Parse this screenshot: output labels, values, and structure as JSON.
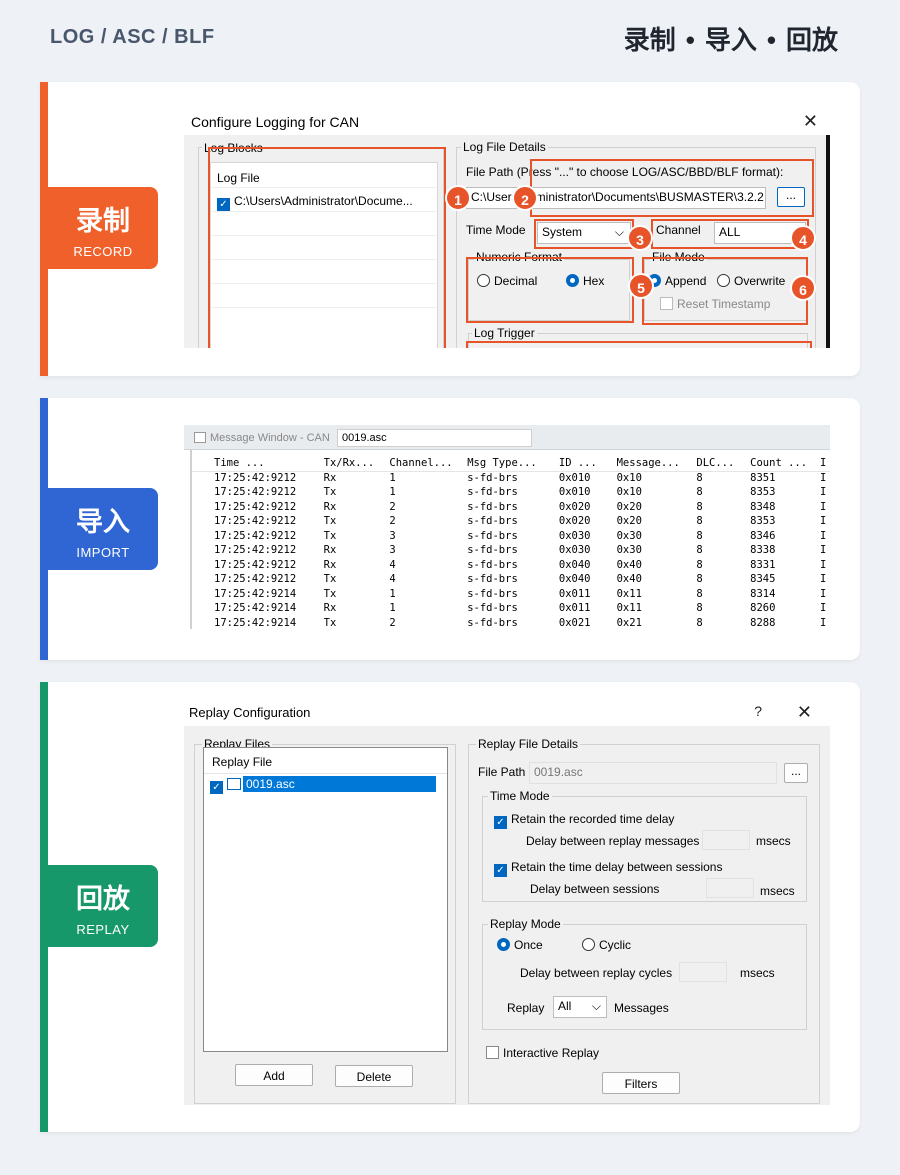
{
  "header": {
    "left": "LOG / ASC / BLF",
    "right": [
      "录制",
      "导入",
      "回放"
    ],
    "dot": "•"
  },
  "colors": {
    "record": "#f0602b",
    "import": "#2f66d4",
    "replay": "#17986a",
    "annot": "#e8542a"
  },
  "record": {
    "badge_cn": "录制",
    "badge_en": "RECORD",
    "window_title": "Configure Logging for CAN",
    "close": "✕",
    "log_blocks_label": "Log Blocks",
    "log_file_header": "Log File",
    "log_file_item": "C:\\Users\\Administrator\\Docume...",
    "details_label": "Log File Details",
    "file_path_label": "File Path (Press \"...\" to choose LOG/ASC/BBD/BLF format):",
    "file_path_value": "C:\\Users\\Administrator\\Documents\\BUSMASTER\\3.2.2",
    "browse": "...",
    "time_mode_label": "Time Mode",
    "time_mode_value": "System",
    "channel_label": "Channel",
    "channel_value": "ALL",
    "numeric_format_label": "Numeric Format",
    "decimal": "Decimal",
    "hex": "Hex",
    "file_mode_label": "File Mode",
    "append": "Append",
    "overwrite": "Overwrite",
    "reset_ts": "Reset Timestamp",
    "log_trigger": "Log Trigger",
    "markers": [
      "1",
      "2",
      "3",
      "4",
      "5",
      "6"
    ]
  },
  "import": {
    "badge_cn": "导入",
    "badge_en": "IMPORT",
    "window_title": "Message Window - CAN",
    "tab": "0019.asc",
    "columns": [
      "Time ...",
      "Tx/Rx...",
      "Channel...",
      "Msg Type...",
      "ID ...",
      "Message...",
      "DLC...",
      "Count ...",
      "I"
    ],
    "rows": [
      [
        "17:25:42:9212",
        "Rx",
        "1",
        "s-fd-brs",
        "0x010",
        "0x10",
        "8",
        "8351",
        "I"
      ],
      [
        "17:25:42:9212",
        "Tx",
        "1",
        "s-fd-brs",
        "0x010",
        "0x10",
        "8",
        "8353",
        "I"
      ],
      [
        "17:25:42:9212",
        "Rx",
        "2",
        "s-fd-brs",
        "0x020",
        "0x20",
        "8",
        "8348",
        "I"
      ],
      [
        "17:25:42:9212",
        "Tx",
        "2",
        "s-fd-brs",
        "0x020",
        "0x20",
        "8",
        "8353",
        "I"
      ],
      [
        "17:25:42:9212",
        "Tx",
        "3",
        "s-fd-brs",
        "0x030",
        "0x30",
        "8",
        "8346",
        "I"
      ],
      [
        "17:25:42:9212",
        "Rx",
        "3",
        "s-fd-brs",
        "0x030",
        "0x30",
        "8",
        "8338",
        "I"
      ],
      [
        "17:25:42:9212",
        "Rx",
        "4",
        "s-fd-brs",
        "0x040",
        "0x40",
        "8",
        "8331",
        "I"
      ],
      [
        "17:25:42:9212",
        "Tx",
        "4",
        "s-fd-brs",
        "0x040",
        "0x40",
        "8",
        "8345",
        "I"
      ],
      [
        "17:25:42:9214",
        "Tx",
        "1",
        "s-fd-brs",
        "0x011",
        "0x11",
        "8",
        "8314",
        "I"
      ],
      [
        "17:25:42:9214",
        "Rx",
        "1",
        "s-fd-brs",
        "0x011",
        "0x11",
        "8",
        "8260",
        "I"
      ],
      [
        "17:25:42:9214",
        "Tx",
        "2",
        "s-fd-brs",
        "0x021",
        "0x21",
        "8",
        "8288",
        "I"
      ]
    ]
  },
  "replay": {
    "badge_cn": "回放",
    "badge_en": "REPLAY",
    "window_title": "Replay Configuration",
    "help": "?",
    "close": "✕",
    "files_label": "Replay Files",
    "file_header": "Replay File",
    "file_item": "0019.asc",
    "add": "Add",
    "delete": "Delete",
    "details_label": "Replay File Details",
    "file_path_label": "File Path",
    "file_path_value": "0019.asc",
    "browse": "...",
    "time_mode_label": "Time Mode",
    "retain_recorded": "Retain the recorded time delay",
    "delay_messages": "Delay between replay messages",
    "retain_sessions": "Retain the time delay between sessions",
    "delay_sessions": "Delay between sessions",
    "msecs": "msecs",
    "replay_mode_label": "Replay Mode",
    "once": "Once",
    "cyclic": "Cyclic",
    "delay_cycles": "Delay between replay cycles",
    "replay_label": "Replay",
    "replay_value": "All",
    "messages_label": "Messages",
    "interactive": "Interactive Replay",
    "filters": "Filters"
  }
}
